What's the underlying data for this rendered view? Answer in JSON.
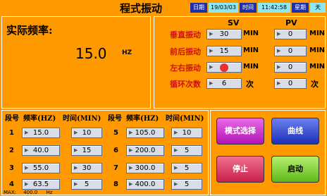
{
  "header": {
    "title": "程式振动",
    "date_label": "日期",
    "date_value": "19/03/03",
    "time_label": "时间",
    "time_value": "11:42:58",
    "week_label": "星期",
    "week_value": "天"
  },
  "freq_panel": {
    "label": "实际频率:",
    "value": "15.0",
    "unit": "HZ"
  },
  "vib_panel": {
    "sv_header": "SV",
    "pv_header": "PV",
    "unit_min": "MIN",
    "unit_ci": "次",
    "rows": [
      {
        "label": "垂直振动",
        "sv": "30",
        "pv": "0"
      },
      {
        "label": "前后振动",
        "sv": "15",
        "pv": "0"
      },
      {
        "label": "左右振动",
        "sv": "",
        "pv": "0"
      },
      {
        "label": "循环次数",
        "sv": "6",
        "pv": "0"
      }
    ]
  },
  "segments": {
    "headers": {
      "seg": "段号",
      "freq": "频率(HZ)",
      "time": "时间(MIN)"
    },
    "left": [
      {
        "no": "1",
        "freq": "15.0",
        "time": "10"
      },
      {
        "no": "2",
        "freq": "40.0",
        "time": "15"
      },
      {
        "no": "3",
        "freq": "55.0",
        "time": "30"
      },
      {
        "no": "4",
        "freq": "63.5",
        "time": "5"
      }
    ],
    "right": [
      {
        "no": "5",
        "freq": "105.0",
        "time": "10"
      },
      {
        "no": "6",
        "freq": "200.0",
        "time": "5"
      },
      {
        "no": "7",
        "freq": "300.0",
        "time": "5"
      },
      {
        "no": "8",
        "freq": "400.0",
        "time": "5"
      }
    ],
    "max_label": "MAX:",
    "max_value": "400.0",
    "max_unit": "Hz"
  },
  "buttons": {
    "mode": "模式选择",
    "curve": "曲线",
    "stop": "停止",
    "start": "启动"
  },
  "colors": {
    "background": "#ff9900",
    "mode_button": "#d21ed2",
    "curve_button": "#2a3fd6",
    "stop_button": "#e23b6a",
    "start_button": "#7ad12a"
  }
}
